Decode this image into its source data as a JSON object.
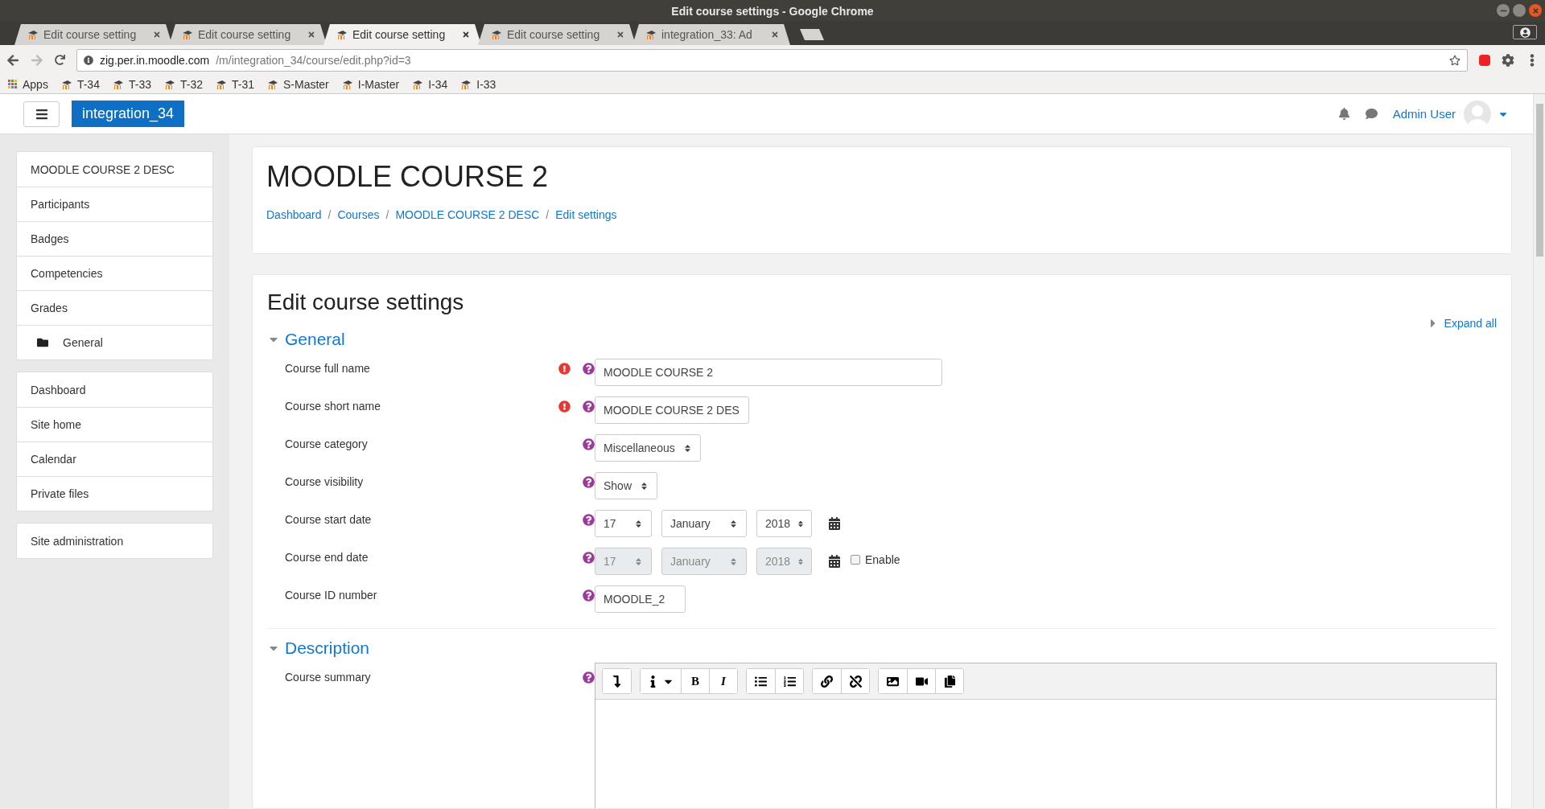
{
  "window": {
    "title": "Edit course settings - Google Chrome"
  },
  "tabs": [
    {
      "title": "Edit course setting",
      "selected": false
    },
    {
      "title": "Edit course setting",
      "selected": false
    },
    {
      "title": "Edit course setting",
      "selected": true
    },
    {
      "title": "Edit course setting",
      "selected": false
    },
    {
      "title": "integration_33: Ad",
      "selected": false
    }
  ],
  "address": {
    "host": "zig.per.in.moodle.com",
    "path": "/m/integration_34/course/edit.php?id=3"
  },
  "bookmarks": [
    {
      "label": "Apps",
      "kind": "apps"
    },
    {
      "label": "T-34",
      "kind": "site"
    },
    {
      "label": "T-33",
      "kind": "site"
    },
    {
      "label": "T-32",
      "kind": "site"
    },
    {
      "label": "T-31",
      "kind": "site"
    },
    {
      "label": "S-Master",
      "kind": "site"
    },
    {
      "label": "I-Master",
      "kind": "site"
    },
    {
      "label": "I-34",
      "kind": "site"
    },
    {
      "label": "I-33",
      "kind": "site"
    }
  ],
  "navbar": {
    "brand": "integration_34",
    "user": "Admin User"
  },
  "sidebar": {
    "groups": [
      [
        {
          "label": "MOODLE COURSE 2 DESC",
          "kind": "link"
        },
        {
          "label": "Participants",
          "kind": "link"
        },
        {
          "label": "Badges",
          "kind": "link"
        },
        {
          "label": "Competencies",
          "kind": "link"
        },
        {
          "label": "Grades",
          "kind": "link"
        },
        {
          "label": "General",
          "kind": "section"
        }
      ],
      [
        {
          "label": "Dashboard",
          "kind": "link"
        },
        {
          "label": "Site home",
          "kind": "link"
        },
        {
          "label": "Calendar",
          "kind": "link"
        },
        {
          "label": "Private files",
          "kind": "link"
        }
      ],
      [
        {
          "label": "Site administration",
          "kind": "link"
        }
      ]
    ]
  },
  "page": {
    "title": "MOODLE COURSE 2",
    "breadcrumbs": [
      {
        "label": "Dashboard"
      },
      {
        "separator": "/",
        "label": "Courses"
      },
      {
        "separator": "/",
        "label": "MOODLE COURSE 2 DESC"
      },
      {
        "separator": "/",
        "label": "Edit settings"
      }
    ]
  },
  "form": {
    "title": "Edit course settings",
    "expand_all": "Expand all",
    "sections": [
      {
        "title": "General",
        "expanded": true,
        "fields": [
          {
            "label": "Course full name",
            "required": true,
            "kind": "text",
            "value": "MOODLE COURSE 2"
          },
          {
            "label": "Course short name",
            "required": true,
            "kind": "text",
            "value": "MOODLE COURSE 2 DES"
          },
          {
            "label": "Course category",
            "required": false,
            "kind": "select",
            "value": "Miscellaneous"
          },
          {
            "label": "Course visibility",
            "required": false,
            "kind": "select",
            "value": "Show"
          },
          {
            "label": "Course start date",
            "required": false,
            "kind": "date",
            "day": "17",
            "month": "January",
            "year": "2018",
            "disabled": false
          },
          {
            "label": "Course end date",
            "required": false,
            "kind": "date",
            "day": "17",
            "month": "January",
            "year": "2018",
            "disabled": true,
            "enable": {
              "label": "Enable",
              "checked": false
            }
          },
          {
            "label": "Course ID number",
            "required": false,
            "kind": "text",
            "value": "MOODLE_2"
          }
        ]
      },
      {
        "title": "Description",
        "expanded": true,
        "fields": [
          {
            "label": "Course summary",
            "required": false,
            "kind": "editor",
            "toolbar": [
              [
                {
                  "kind": "collapse"
                }
              ],
              [
                {
                  "kind": "style"
                },
                {
                  "kind": "bold",
                  "label": "B"
                },
                {
                  "kind": "italic",
                  "label": "I"
                }
              ],
              [
                {
                  "kind": "bullets"
                },
                {
                  "kind": "numbers"
                }
              ],
              [
                {
                  "kind": "link"
                },
                {
                  "kind": "unlink"
                }
              ],
              [
                {
                  "kind": "image"
                },
                {
                  "kind": "video"
                },
                {
                  "kind": "files"
                }
              ]
            ]
          }
        ]
      }
    ]
  }
}
